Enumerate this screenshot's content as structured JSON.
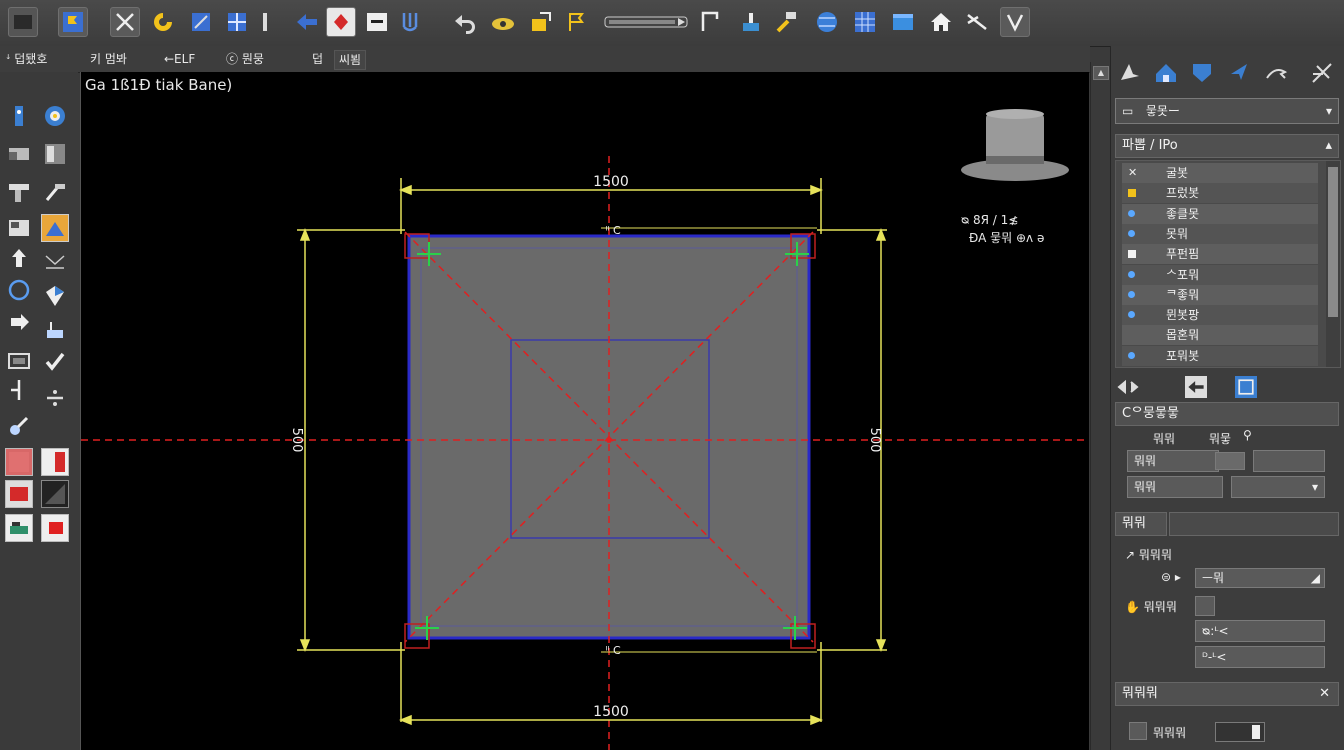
{
  "toolbar": {
    "buttons": [
      {
        "icon": "select-icon"
      },
      {
        "icon": "flag-blue-icon"
      },
      {
        "icon": "cross-arrow-icon"
      },
      {
        "icon": "swirl-icon"
      },
      {
        "icon": "mirror-icon"
      },
      {
        "icon": "puzzle-icon"
      },
      {
        "icon": "divider-icon"
      },
      {
        "icon": "arrow-left-icon"
      },
      {
        "icon": "diamond-red-icon"
      },
      {
        "icon": "tablet-icon"
      },
      {
        "icon": "fork-icon"
      },
      {
        "icon": "undo-icon"
      },
      {
        "icon": "eye-icon"
      },
      {
        "icon": "pencil-icon"
      },
      {
        "icon": "flag-icon"
      },
      {
        "icon": "slider-bar-icon"
      },
      {
        "icon": "corner-icon"
      },
      {
        "icon": "stand-icon"
      },
      {
        "icon": "hammer-icon"
      },
      {
        "icon": "globe-icon"
      },
      {
        "icon": "grid-icon"
      },
      {
        "icon": "plane-icon"
      },
      {
        "icon": "house-icon"
      },
      {
        "icon": "scissors-icon"
      },
      {
        "icon": "check-icon"
      }
    ]
  },
  "menu_row": {
    "items": [
      "ꜜ 덥됐호",
      "키 멈봐",
      "←ELF",
      "ⓒ 뭔뭉",
      "덥",
      "씨뵘"
    ]
  },
  "viewport": {
    "label": "Ga 1ß1Ð  tiak Bane)",
    "dim_top": "1500",
    "dim_bottom": "1500",
    "dim_left": "500",
    "dim_right": "500",
    "tick_top": "ᴵᴵ C",
    "tick_bottom": "ᴵᴵ C",
    "note_line1": "ᴓ 8Я / 1≴",
    "note_line2": "ÐA 뭏뭐 ⊕ᴧ ə"
  },
  "right_panel": {
    "top_buttons": [
      {
        "icon": "panel-select-icon"
      },
      {
        "icon": "panel-house-icon"
      },
      {
        "icon": "panel-shield-icon"
      },
      {
        "icon": "panel-cursor-icon"
      },
      {
        "icon": "panel-arrow-icon"
      },
      {
        "icon": "panel-network-icon"
      }
    ],
    "dropdown_value": "뭏못ー",
    "list_header": "파뽑 / ⅠPo",
    "list_items": [
      {
        "label": "굴봇",
        "bullet": "x"
      },
      {
        "label": "프렀봇",
        "bullet": "square-yellow"
      },
      {
        "label": "좋클못",
        "bullet": "dot-blue"
      },
      {
        "label": "못뭐",
        "bullet": "dot-blue"
      },
      {
        "label": "푸펀핌",
        "bullet": "square-white"
      },
      {
        "label": "ᄉ포뭐",
        "bullet": "dot-blue"
      },
      {
        "label": "ᄏ좋뭐",
        "bullet": "dot-blue"
      },
      {
        "label": "뮌봇팡",
        "bullet": "dot-blue"
      },
      {
        "label": "몹혼뭐",
        "bullet": "none"
      },
      {
        "label": "포뭐봇",
        "bullet": "dot-blue"
      }
    ],
    "props_header": "Cᄋ뭉뭏뭏",
    "prop_label_a": "뭐뭐",
    "prop_label_b": "뭐뭏",
    "prop_field_a": "뭐뭐",
    "prop_field_b": "뭐뭐",
    "section2_header": "뭐뭐",
    "sub_label_1": "뭐뭐뭐",
    "sub_label_2": "뭐뭐뭐",
    "sub_field_1": "ㅡ뭐",
    "sub_field_2": "ᴓ:ᴸ<",
    "sub_field_3": "ᴰ-ᴸ<",
    "section3_header": "뭐뭐뭐",
    "bottom_label": "뭐뭐뭐"
  },
  "colors": {
    "dimension": "#e6e25a",
    "centerline": "#e02020",
    "plate_fill": "#6a6a6a",
    "plate_edge": "#2a2ac8"
  }
}
